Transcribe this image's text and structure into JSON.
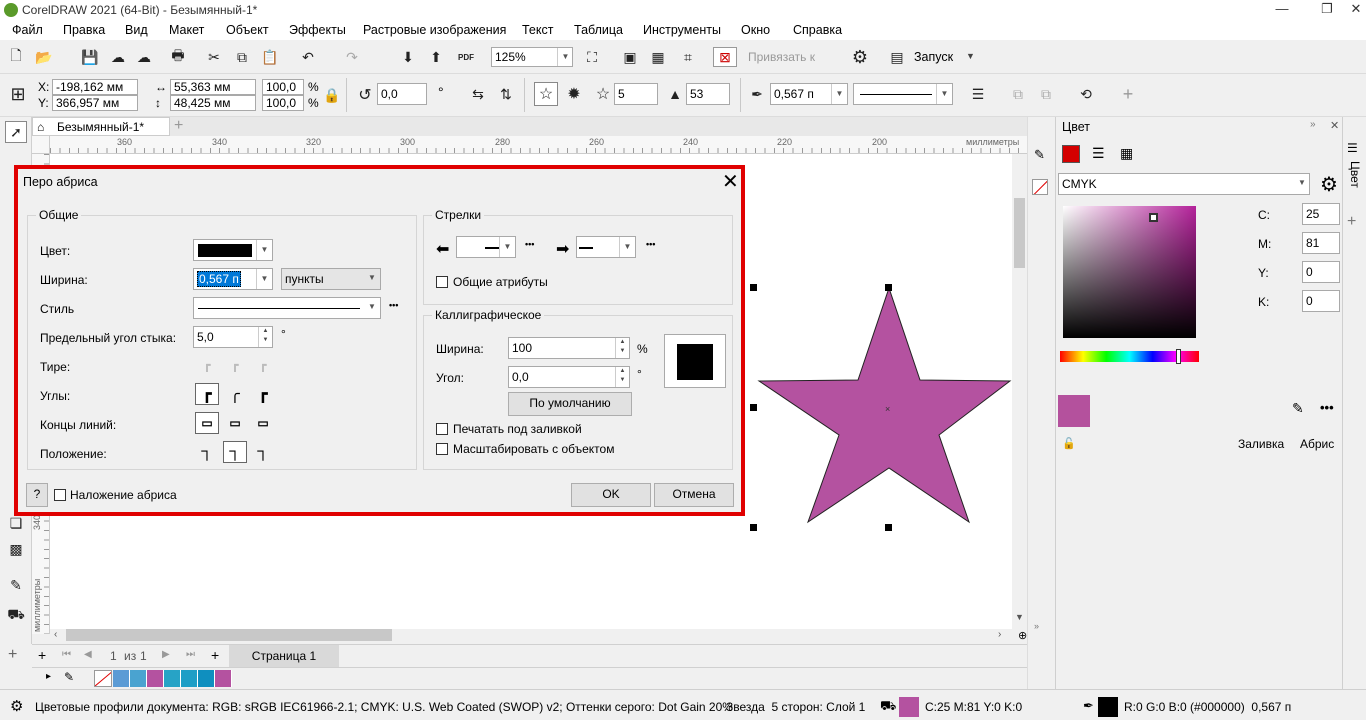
{
  "app": {
    "title": "CorelDRAW 2021 (64-Bit) - Безымянный-1*",
    "minimize": "—",
    "maximize": "❐",
    "close": "✕"
  },
  "menu": [
    "Файл",
    "Правка",
    "Вид",
    "Макет",
    "Объект",
    "Эффекты",
    "Растровые изображения",
    "Текст",
    "Таблица",
    "Инструменты",
    "Окно",
    "Справка"
  ],
  "standard_toolbar": {
    "zoom": "125%",
    "snap_label": "Привязать к",
    "launch_label": "Запуск",
    "pdf_label": "PDF"
  },
  "property_bar": {
    "x_label": "X:",
    "x": "-198,162 мм",
    "y_label": "Y:",
    "y": "366,957 мм",
    "width": "55,363 мм",
    "height": "48,425 мм",
    "scale_w": "100,0",
    "scale_h": "100,0",
    "pct": "%",
    "rotation": "0,0",
    "points": "5",
    "sharpness": "53",
    "outline_width": "0,567 п"
  },
  "doc_tab": {
    "label": "Безымянный-1*",
    "add": "+"
  },
  "ruler": {
    "h_ticks": [
      "360",
      "340",
      "320",
      "300",
      "280",
      "260",
      "240",
      "220",
      "200"
    ],
    "h_unit": "миллиметры",
    "v_ticks": [
      "340"
    ],
    "v_unit": "миллиметры"
  },
  "page_nav": {
    "current": "1",
    "of_label": "из",
    "total": "1",
    "page_tab": "Страница 1"
  },
  "palette": {
    "swatches": [
      "#5b9bd5",
      "#4aa3d0",
      "#b452a0",
      "#27a3c6",
      "#1e9ec6",
      "#0f8fbf",
      "#b452a0"
    ]
  },
  "colors": {
    "star_fill": "#b452a0",
    "dialog_border": "#e00000",
    "selected_swatch": "#b4519d"
  },
  "dialog": {
    "title": "Перо абриса",
    "general_title": "Общие",
    "color_label": "Цвет:",
    "width_label": "Ширина:",
    "width_value": "0,567 п",
    "width_unit": "пункты",
    "style_label": "Стиль",
    "miter_label": "Предельный угол стыка:",
    "miter_value": "5,0",
    "degree": "°",
    "dash_label": "Тире:",
    "corners_label": "Углы:",
    "caps_label": "Концы линий:",
    "position_label": "Положение:",
    "arrows_title": "Стрелки",
    "shared_attrs": "Общие атрибуты",
    "calligraphy_title": "Каллиграфическое",
    "cal_width_label": "Ширина:",
    "cal_width_value": "100",
    "cal_pct": "%",
    "cal_angle_label": "Угол:",
    "cal_angle_value": "0,0",
    "cal_degree": "°",
    "default_button": "По умолчанию",
    "print_behind": "Печатать под заливкой",
    "scale_with_object": "Масштабировать с объектом",
    "help": "?",
    "overprint": "Наложение абриса",
    "ok": "OK",
    "cancel": "Отмена",
    "more": "•••"
  },
  "docker": {
    "title": "Цвет",
    "model": "CMYK",
    "c_label": "C:",
    "c": "25",
    "m_label": "M:",
    "m": "81",
    "y_label": "Y:",
    "y": "0",
    "k_label": "K:",
    "k": "0",
    "fill_label": "Заливка",
    "outline_label": "Абрис",
    "tab_label": "Цвет"
  },
  "status": {
    "profiles": "Цветовые профили документа: RGB: sRGB IEC61966-2.1; CMYK: U.S. Web Coated (SWOP) v2; Оттенки серого: Dot Gain 20%",
    "object": "Звезда  5 сторон: Слой 1",
    "fill_info": "C:25 M:81 Y:0 K:0",
    "outline_info": "R:0 G:0 B:0 (#000000)  0,567 п"
  }
}
